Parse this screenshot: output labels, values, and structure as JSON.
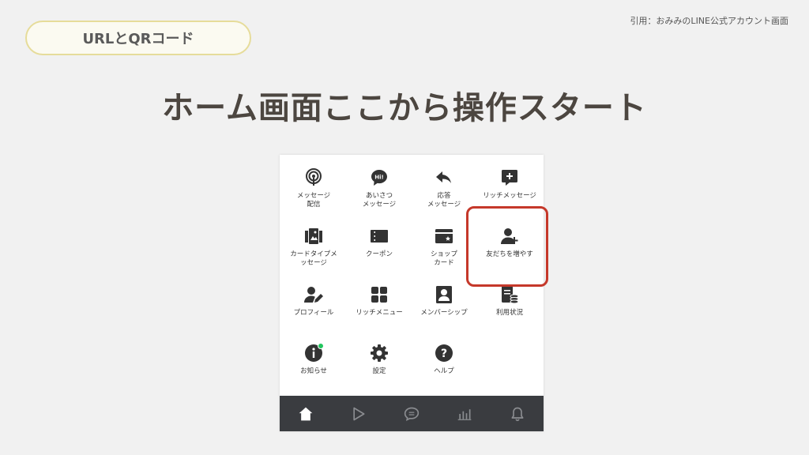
{
  "badge": {
    "label": "URLとQRコード"
  },
  "citation": "引用：おみみのLINE公式アカウント画面",
  "headline": "ホーム画面ここから操作スタート",
  "menu": {
    "items": [
      {
        "label": "メッセージ\n配信",
        "icon": "broadcast-icon"
      },
      {
        "label": "あいさつ\nメッセージ",
        "icon": "greeting-bubble-icon"
      },
      {
        "label": "応答\nメッセージ",
        "icon": "reply-arrow-icon"
      },
      {
        "label": "リッチメッセージ",
        "icon": "rich-message-icon"
      },
      {
        "label": "カードタイプメ\nッセージ",
        "icon": "card-type-icon"
      },
      {
        "label": "クーポン",
        "icon": "coupon-icon"
      },
      {
        "label": "ショップ\nカード",
        "icon": "shop-card-icon"
      },
      {
        "label": "友だちを増やす",
        "icon": "add-friend-icon"
      },
      {
        "label": "プロフィール",
        "icon": "profile-edit-icon"
      },
      {
        "label": "リッチメニュー",
        "icon": "rich-menu-icon"
      },
      {
        "label": "メンバーシップ",
        "icon": "membership-icon"
      },
      {
        "label": "利用状況",
        "icon": "usage-icon"
      },
      {
        "label": "お知らせ",
        "icon": "info-icon"
      },
      {
        "label": "設定",
        "icon": "settings-gear-icon"
      },
      {
        "label": "ヘルプ",
        "icon": "help-icon"
      }
    ],
    "highlighted_item": "友だちを増やす"
  },
  "tabbar": {
    "tabs": [
      "home-icon",
      "play-icon",
      "chat-icon",
      "chart-icon",
      "bell-icon"
    ],
    "active": "home-icon"
  },
  "colors": {
    "highlight": "#c5382a",
    "badge_border": "#e6dc9a",
    "tabbar": "#3a3c40",
    "notification_dot": "#22c55e"
  }
}
